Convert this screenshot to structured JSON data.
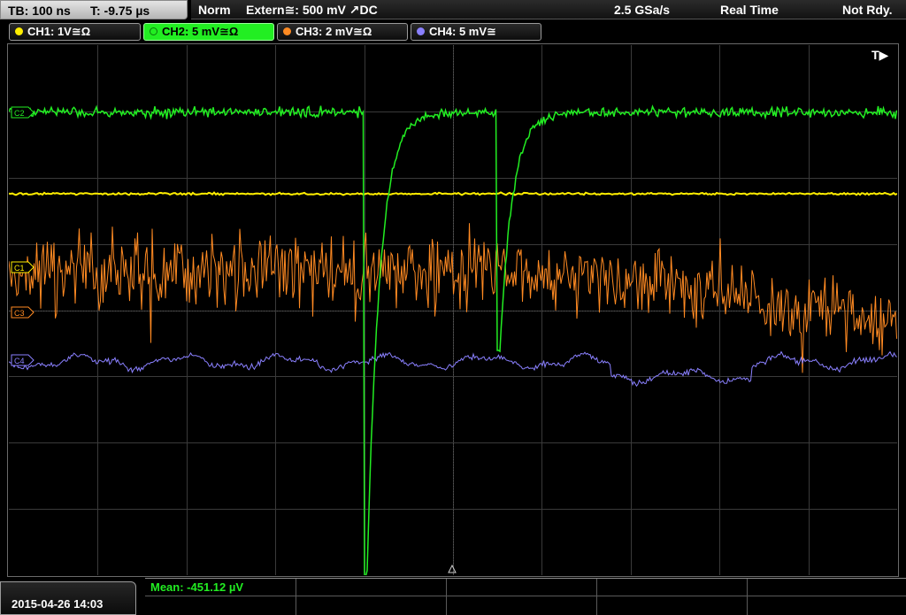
{
  "header": {
    "timebase": "TB: 100 ns",
    "trigger_time": "T: -9.75 µs",
    "mode": "Norm",
    "trigger": "Extern≅: 500 mV ↗DC",
    "sample_rate": "2.5 GSa/s",
    "acquire": "Real Time",
    "status": "Not Rdy."
  },
  "channels": [
    {
      "label": "CH1: 1V≅Ω",
      "color": "#ffee00"
    },
    {
      "label": "CH2: 5 mV≅Ω",
      "color": "#22ee22"
    },
    {
      "label": "CH3: 2 mV≅Ω",
      "color": "#ff8a22"
    },
    {
      "label": "CH4: 5 mV≅",
      "color": "#8a80ff"
    }
  ],
  "markers": {
    "ch2": "C2",
    "ch1": "C1",
    "ch3": "C3",
    "ch4": "C4",
    "trigger": "T▶"
  },
  "measurement": {
    "label": "Mean: -451.12 µV",
    "color": "#22ee22"
  },
  "footer": {
    "date": "2015-04-26 14:03"
  }
}
